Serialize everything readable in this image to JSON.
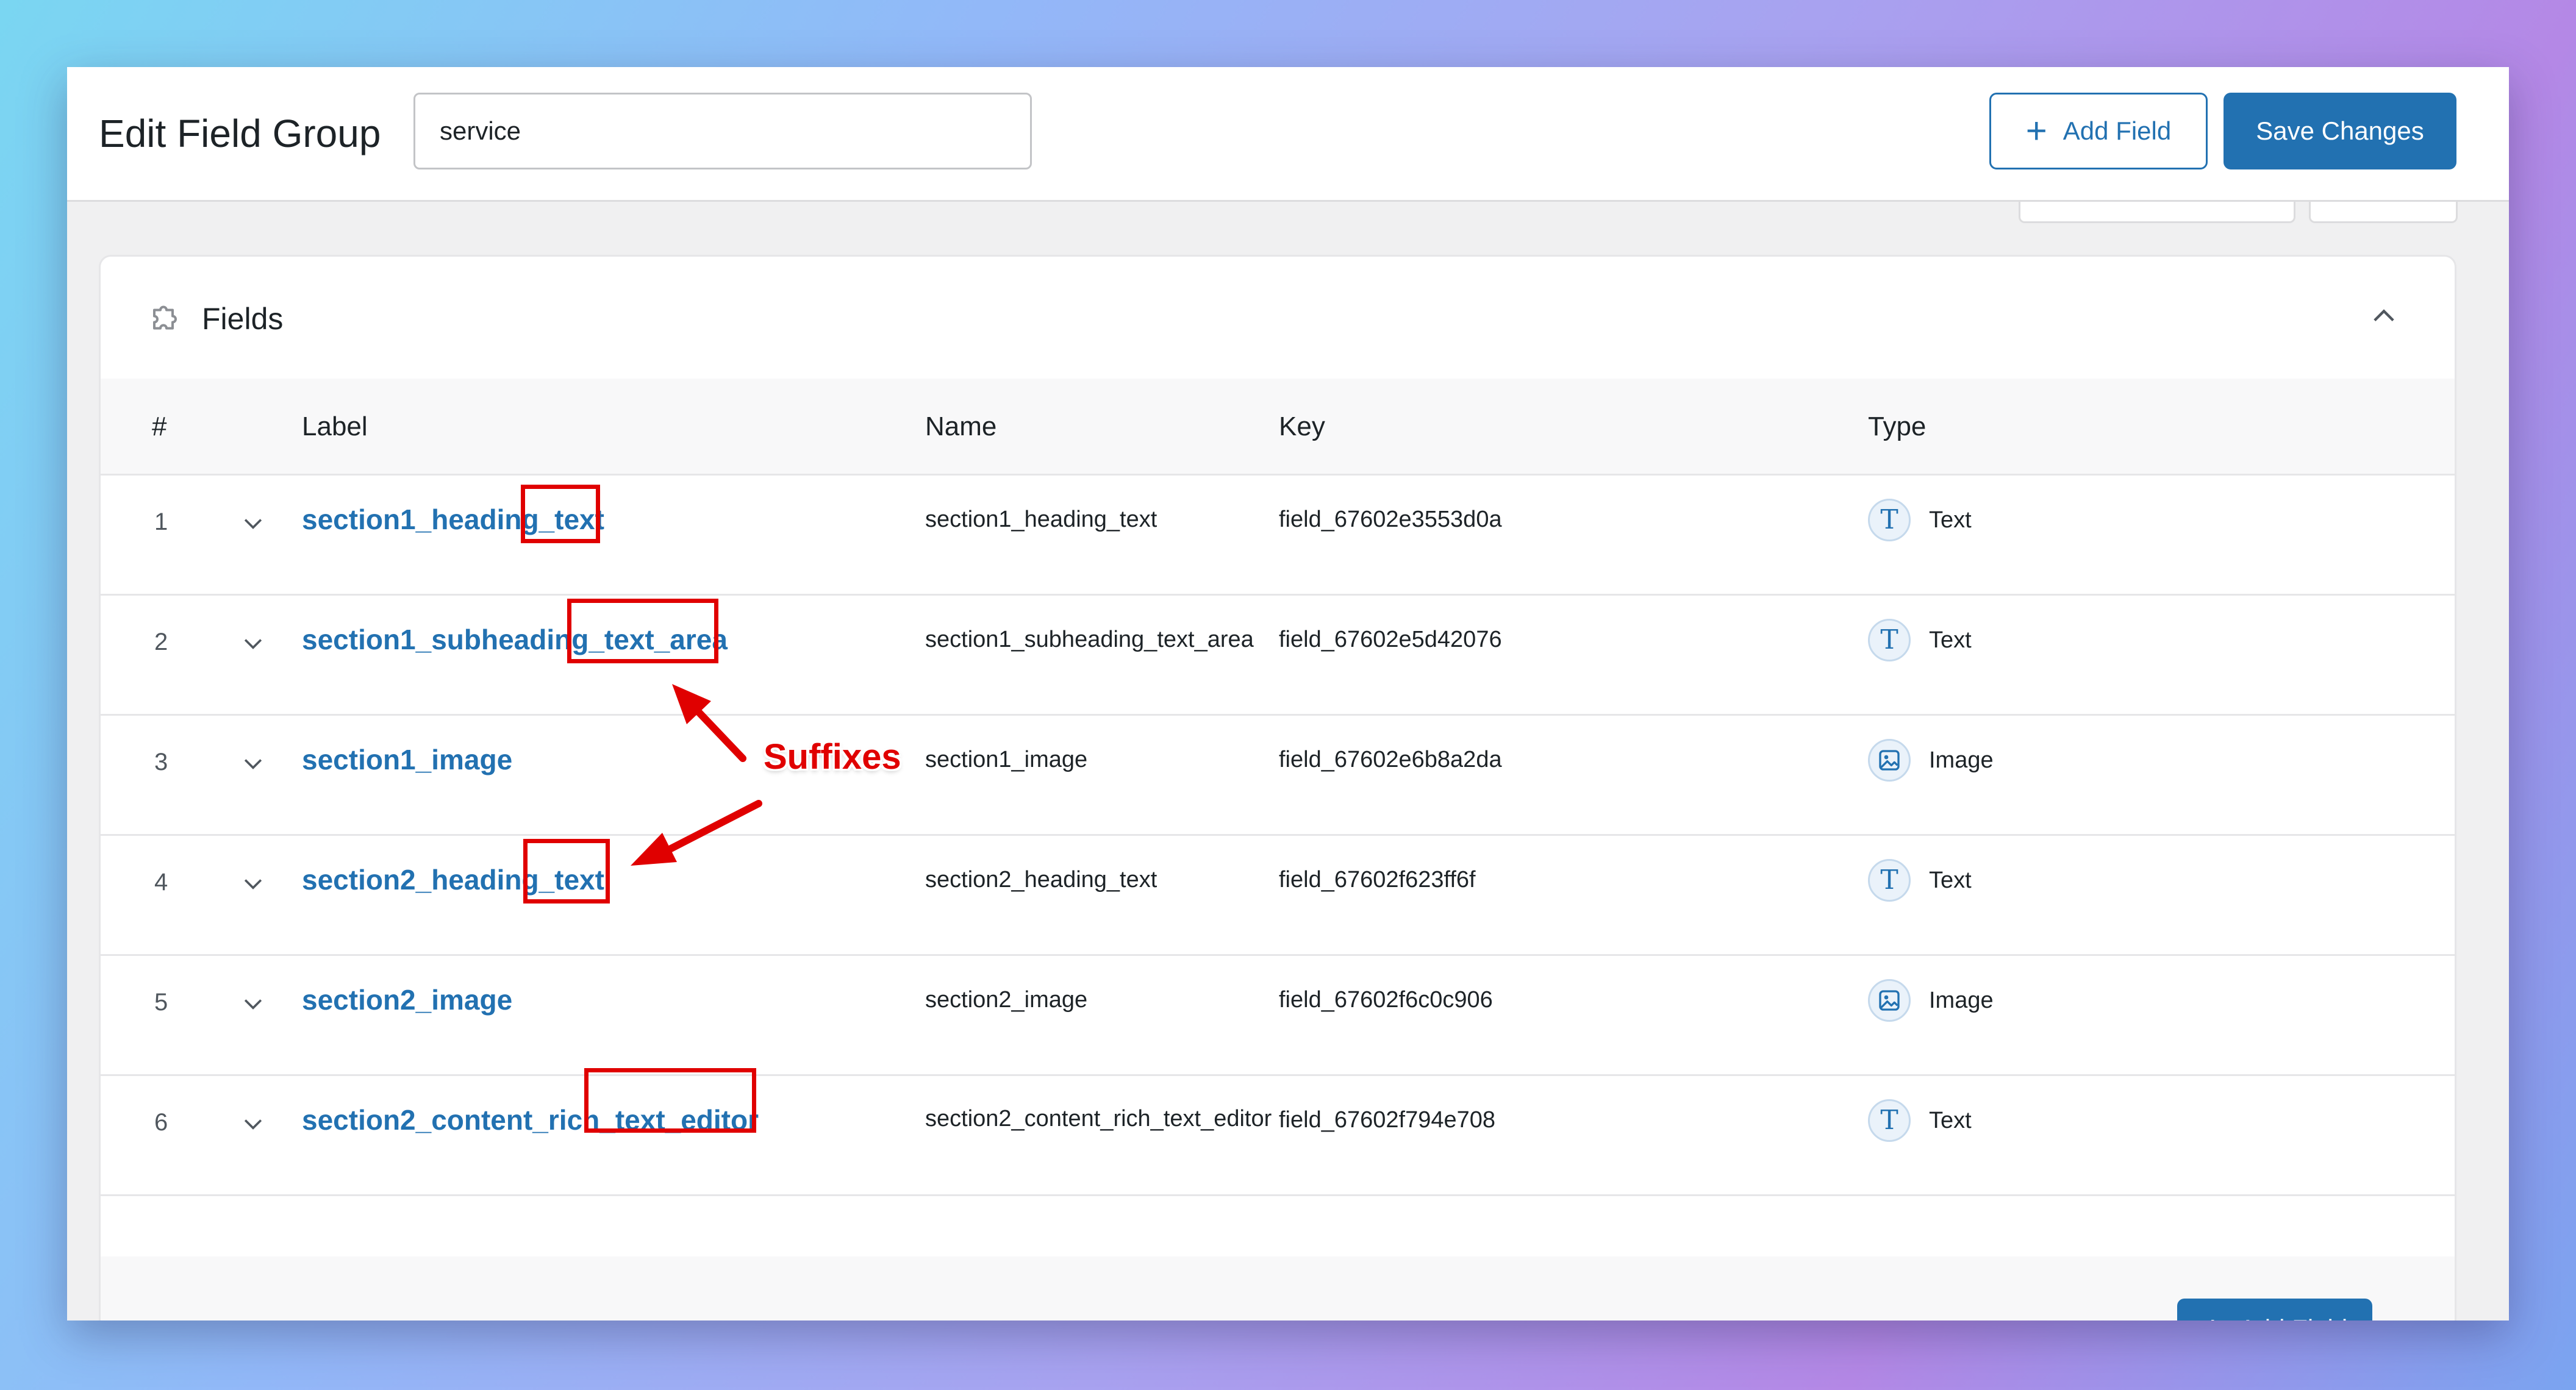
{
  "header": {
    "page_title": "Edit Field Group",
    "group_title_value": "service",
    "add_field_label": "Add Field",
    "save_label": "Save Changes"
  },
  "fields_panel": {
    "title": "Fields",
    "columns": {
      "num": "#",
      "label": "Label",
      "name": "Name",
      "key": "Key",
      "type": "Type"
    },
    "rows": [
      {
        "num": "1",
        "label": "section1_heading_text",
        "name": "section1_heading_text",
        "key": "field_67602e3553d0a",
        "type": "Text",
        "type_icon": "text-type-icon"
      },
      {
        "num": "2",
        "label": "section1_subheading_text_area",
        "name": "section1_subheading_text_area",
        "key": "field_67602e5d42076",
        "type": "Text",
        "type_icon": "text-type-icon"
      },
      {
        "num": "3",
        "label": "section1_image",
        "name": "section1_image",
        "key": "field_67602e6b8a2da",
        "type": "Image",
        "type_icon": "image-type-icon"
      },
      {
        "num": "4",
        "label": "section2_heading_text",
        "name": "section2_heading_text",
        "key": "field_67602f623ff6f",
        "type": "Text",
        "type_icon": "text-type-icon"
      },
      {
        "num": "5",
        "label": "section2_image",
        "name": "section2_image",
        "key": "field_67602f6c0c906",
        "type": "Image",
        "type_icon": "image-type-icon"
      },
      {
        "num": "6",
        "label": "section2_content_rich_text_editor",
        "name": "section2_content_rich_text_editor",
        "key": "field_67602f794e708",
        "type": "Text",
        "type_icon": "text-type-icon"
      }
    ],
    "footer_add_label": "Add Field"
  },
  "annotation": {
    "label": "Suffixes",
    "color": "#e00000"
  },
  "colors": {
    "accent": "#2271b1",
    "annotation": "#e00000"
  }
}
